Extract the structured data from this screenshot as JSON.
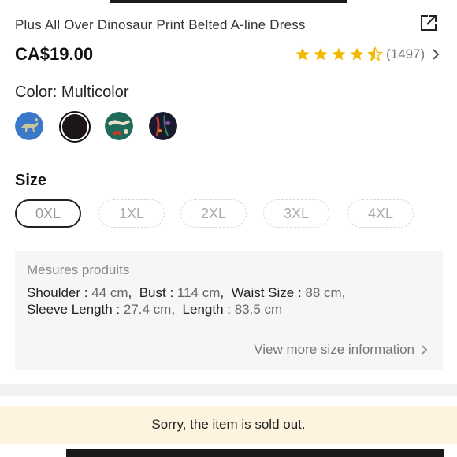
{
  "product": {
    "title": "Plus All Over Dinosaur Print Belted A-line Dress",
    "price": "CA$19.00",
    "rating": 4.5,
    "review_count": "(1497)"
  },
  "color": {
    "label": "Color: Multicolor",
    "swatches": [
      {
        "name": "blue dinosaur print",
        "base": "#3a78c9"
      },
      {
        "name": "black",
        "base": "#1c1616",
        "selected": true
      },
      {
        "name": "teal dinosaur print",
        "base": "#1f6a5a"
      },
      {
        "name": "dark floral print",
        "base": "#1a1a2e"
      }
    ]
  },
  "size": {
    "label": "Size",
    "options": [
      "0XL",
      "1XL",
      "2XL",
      "3XL",
      "4XL"
    ],
    "selected": "0XL"
  },
  "measures": {
    "title": "Mesures produits",
    "line1": [
      {
        "k": "Shoulder",
        "v": "44 cm"
      },
      {
        "k": "Bust",
        "v": "114 cm"
      },
      {
        "k": "Waist Size",
        "v": "88 cm"
      }
    ],
    "line2": [
      {
        "k": "Sleeve Length",
        "v": "27.4 cm"
      },
      {
        "k": "Length",
        "v": "83.5 cm"
      }
    ],
    "more_link": "View more size information"
  },
  "notice": {
    "sold_out": "Sorry, the item is sold out."
  },
  "colors": {
    "star": "#f5b800",
    "soldout_bg": "#fdf3df"
  }
}
